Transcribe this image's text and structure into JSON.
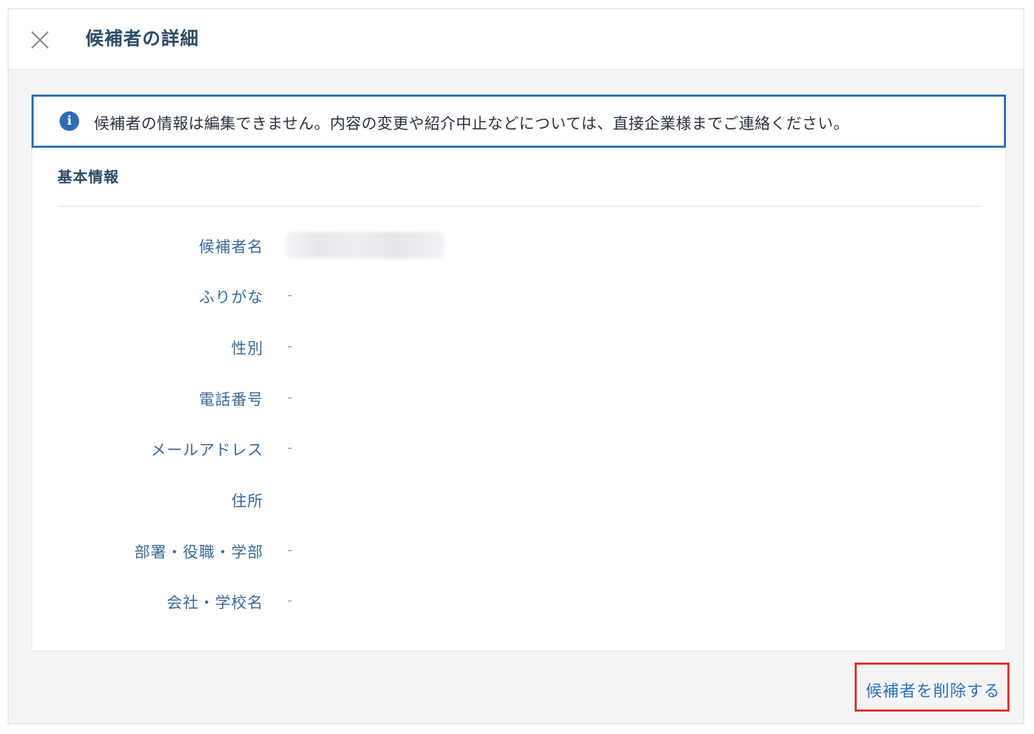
{
  "dialog": {
    "title": "候補者の詳細",
    "close_icon": "close-icon"
  },
  "notice": {
    "icon": "info-icon",
    "icon_glyph": "i",
    "text": "候補者の情報は編集できません。内容の変更や紹介中止などについては、直接企業様までご連絡ください。",
    "accent_color": "#2f6cb5"
  },
  "basic_info": {
    "title": "基本情報",
    "fields": [
      {
        "label": "候補者名",
        "value": "",
        "blurred": true
      },
      {
        "label": "ふりがな",
        "value": "-"
      },
      {
        "label": "性別",
        "value": "-"
      },
      {
        "label": "電話番号",
        "value": "-"
      },
      {
        "label": "メールアドレス",
        "value": "-"
      },
      {
        "label": "住所",
        "value": ""
      },
      {
        "label": "部署・役職・学部",
        "value": "-"
      },
      {
        "label": "会社・学校名",
        "value": "-"
      }
    ]
  },
  "footer": {
    "delete_label": "候補者を削除する",
    "highlight_color": "#e0322c"
  }
}
